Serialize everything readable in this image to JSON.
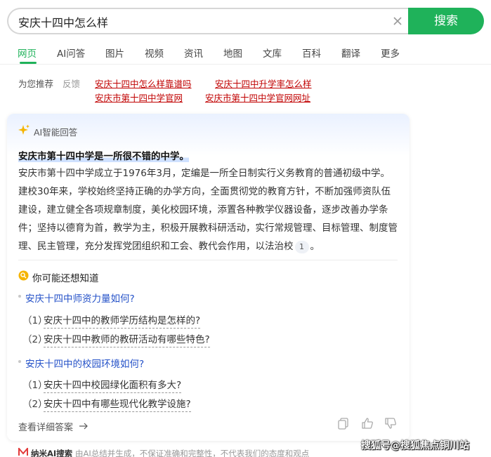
{
  "search": {
    "query": "安庆十四中怎么样",
    "button_label": "搜索"
  },
  "tabs": [
    "网页",
    "AI问答",
    "图片",
    "视频",
    "资讯",
    "地图",
    "文库",
    "百科",
    "翻译",
    "更多"
  ],
  "active_tab": "网页",
  "recommendations": {
    "label": "为您推荐",
    "feedback": "反馈",
    "links": [
      "安庆十四中怎么样靠谱吗",
      "安庆十四中升学率怎么样",
      "安庆市第十四中学官网",
      "安庆市第十四中学官网网址"
    ]
  },
  "ai_answer": {
    "title": "AI智能回答",
    "heading": "安庆市第十四中学是一所很不错的中学。",
    "body": "安庆市第十四中学成立于1976年3月，定编是一所全日制实行义务教育的普通初级中学。建校30年来，学校始终坚持正确的办学方向，全面贯彻党的教育方针，不断加强师资队伍建设，建立健全各项规章制度，美化校园环境，添置各种教学仪器设备，逐步改善办学条件；坚持以德育为首，教学为主，积极开展教科研活动，实行常规管理、目标管理、制度管理、民主管理，充分发挥党团组织和工会、教代会作用，以法治校",
    "citation": "1",
    "body_end": "。",
    "related_title": "你可能还想知道",
    "questions": [
      {
        "text": "安庆十四中师资力量如何?",
        "subs": [
          {
            "num": "（1）",
            "text": "安庆十四中的教师学历结构是怎样的?"
          },
          {
            "num": "（2）",
            "text": "安庆十四中教师的教研活动有哪些特色?"
          }
        ]
      },
      {
        "text": "安庆十四中的校园环境如何?",
        "subs": [
          {
            "num": "（1）",
            "text": "安庆十四中校园绿化面积有多大?"
          },
          {
            "num": "（2）",
            "text": "安庆十四中有哪些现代化教学设施?"
          }
        ]
      }
    ],
    "detail_link": "查看详细答案"
  },
  "footer": {
    "brand": "纳米AI搜索",
    "disclaimer": "由AI总结并生成，不保证准确和完整性，不代表我们的态度和观点",
    "watermark": "搜狐号@搜狐焦点铜川站"
  },
  "colors": {
    "brand_green": "#1fb25a",
    "link_red": "#c00000",
    "question_blue": "#2552c8"
  }
}
